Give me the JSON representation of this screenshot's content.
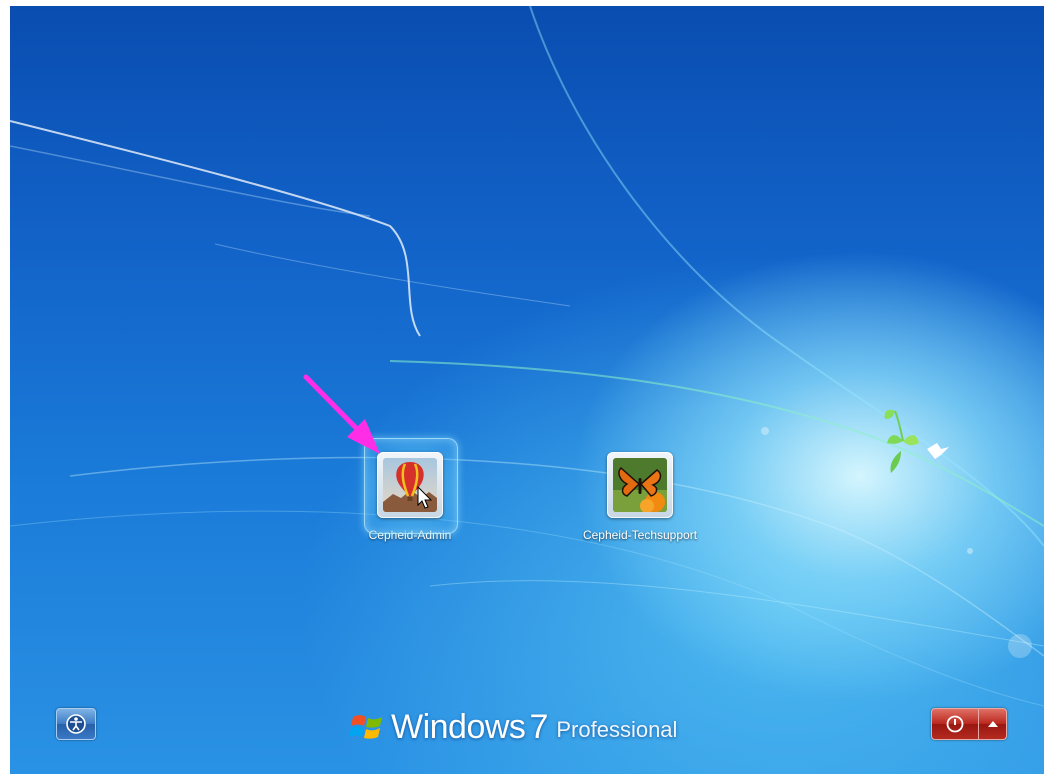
{
  "users": [
    {
      "name": "Cepheid-Admin",
      "picture_icon": "hot-air-balloon-icon",
      "selected": true
    },
    {
      "name": "Cepheid-Techsupport",
      "picture_icon": "butterfly-icon",
      "selected": false
    }
  ],
  "branding": {
    "windows": "Windows",
    "version": "7",
    "edition": "Professional"
  },
  "controls": {
    "ease_of_access_icon": "ease-of-access-icon",
    "shutdown_icon": "power-icon",
    "shutdown_options_icon": "up-arrow-icon"
  },
  "colors": {
    "background": "#1262c8",
    "shutdown_button": "#b9271d",
    "annotation_arrow": "#ff2de6"
  }
}
